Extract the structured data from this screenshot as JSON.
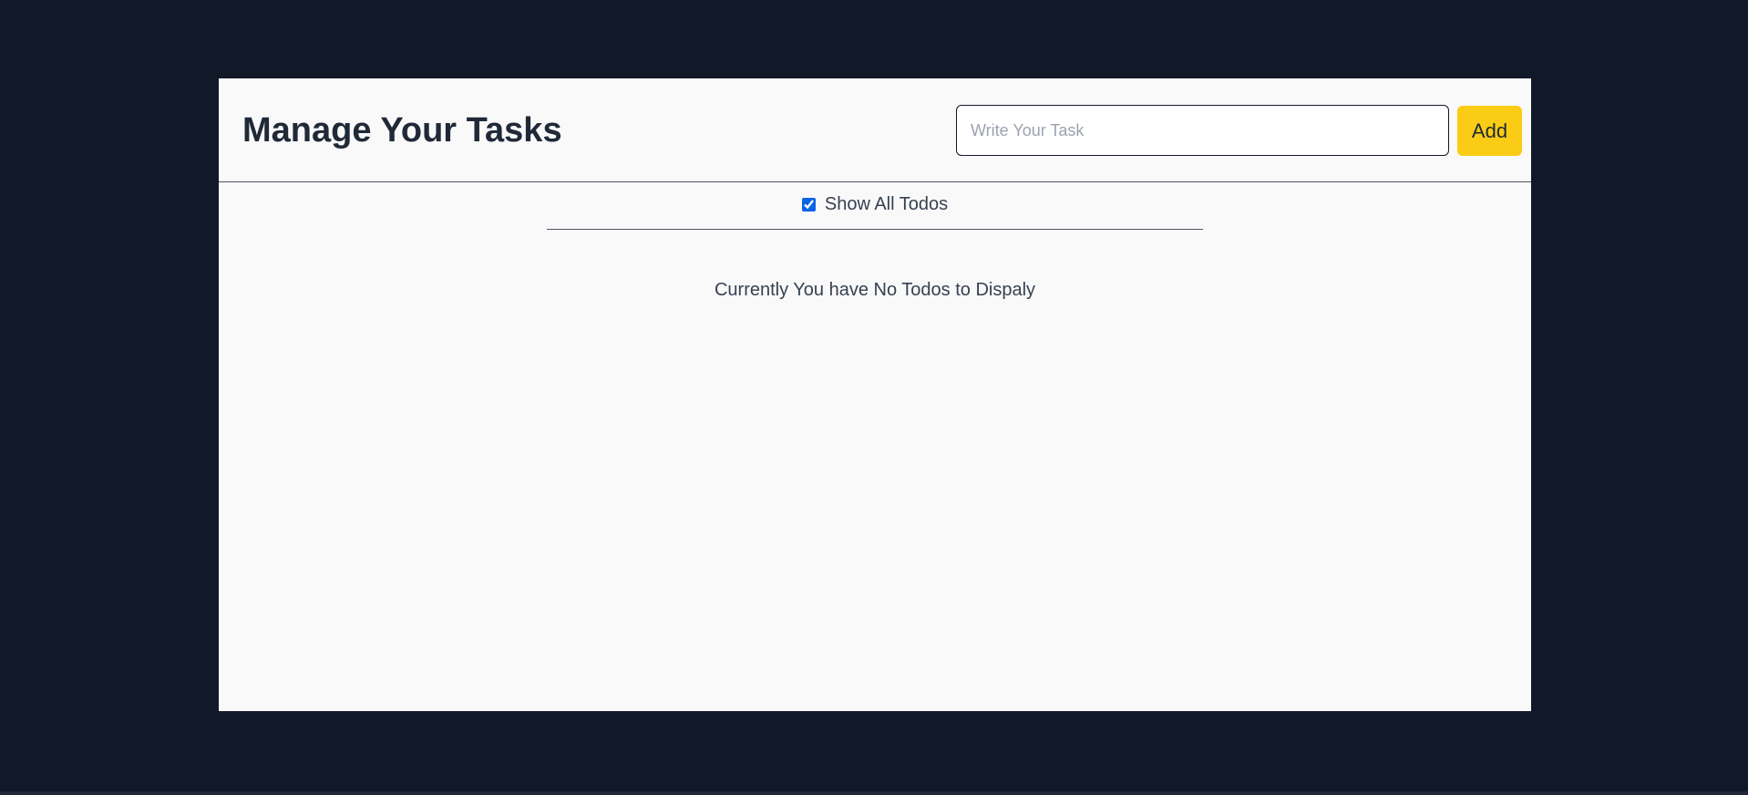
{
  "header": {
    "title": "Manage Your Tasks",
    "task_input": {
      "value": "",
      "placeholder": "Write Your Task"
    },
    "add_button_label": "Add"
  },
  "filter": {
    "label": "Show All Todos",
    "checked": true
  },
  "todos": [],
  "empty_message": "Currently You have No Todos to Dispaly",
  "colors": {
    "page_background": "#111827",
    "card_background": "#f9f9fa",
    "accent_button": "#facc15",
    "checkbox_accent": "#0b63e5"
  }
}
